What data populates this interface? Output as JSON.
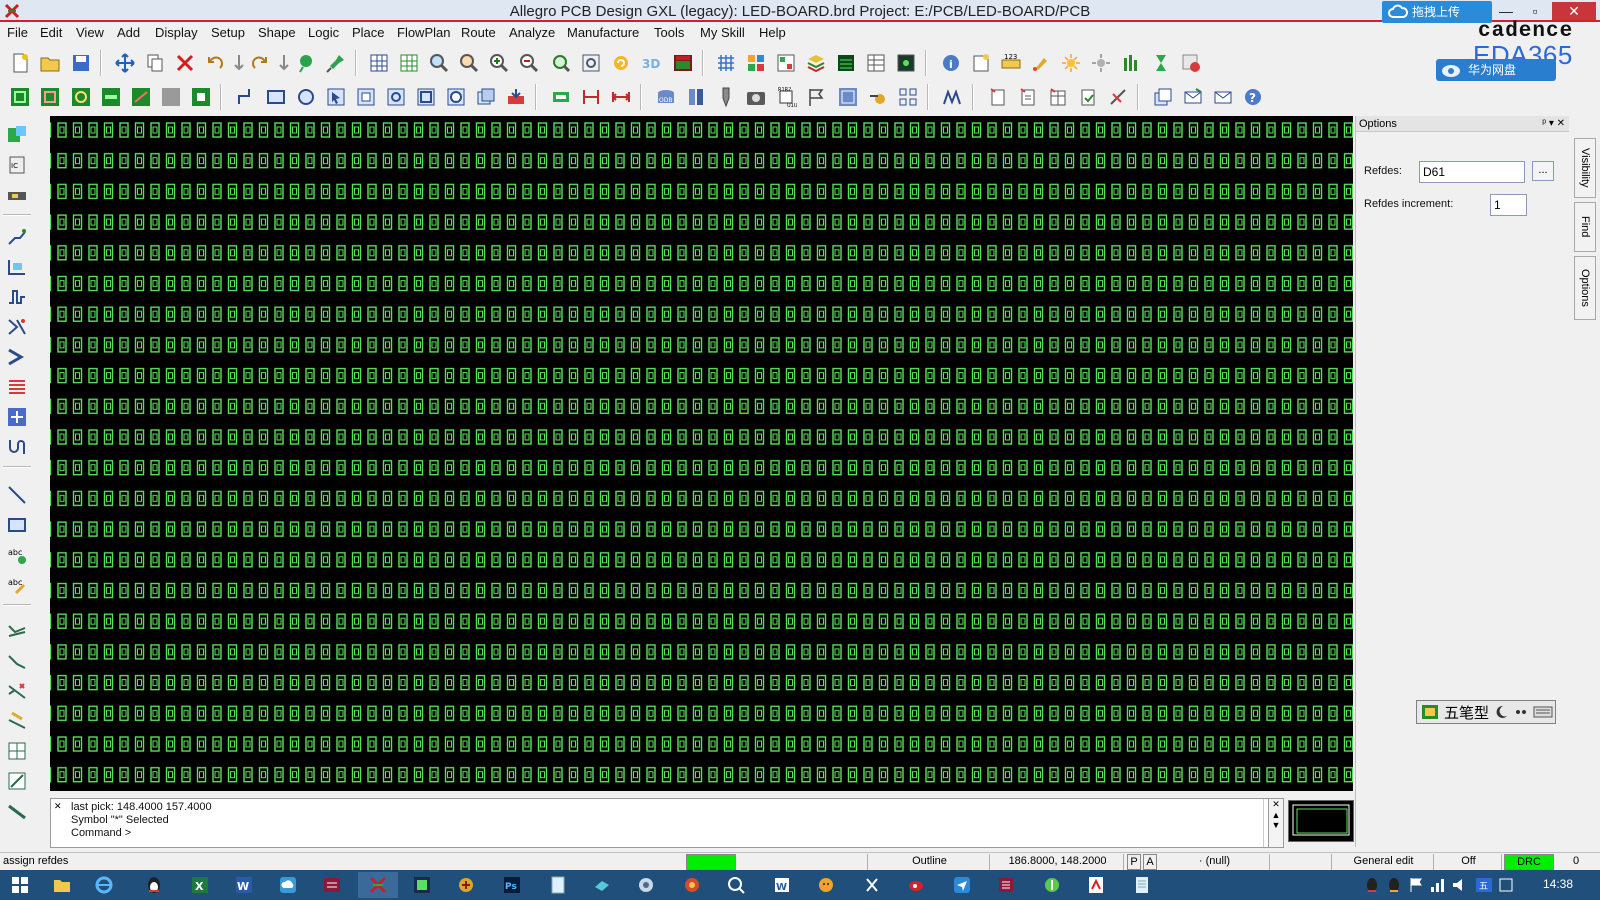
{
  "window": {
    "title": "Allegro PCB Design GXL (legacy): LED-BOARD.brd  Project: E:/PCB/LED-BOARD/PCB",
    "upload_label": "拖拽上传",
    "minimize": "—",
    "maximize": "▫",
    "close": "✕",
    "cadence_text": "cadence",
    "eda_text": "EDA365",
    "netdisk_label": "华为网盘"
  },
  "menu": [
    "File",
    "Edit",
    "View",
    "Add",
    "Display",
    "Setup",
    "Shape",
    "Logic",
    "Place",
    "FlowPlan",
    "Route",
    "Analyze",
    "Manufacture",
    "Tools",
    "My Skill",
    "Help"
  ],
  "options_panel": {
    "header": "Options",
    "header_buttons": "ᵖ ▾ ✕",
    "refdes_label": "Refdes:",
    "refdes_value": "D61",
    "browse_label": "...",
    "increment_label": "Refdes increment:",
    "increment_value": "1",
    "ime_text": "五笔型"
  },
  "side_tabs": [
    "Visibility",
    "Find",
    "Options"
  ],
  "command_window": {
    "lines": [
      "last pick:  148.4000 157.4000",
      "Symbol \"*\" Selected",
      "Command >"
    ]
  },
  "status": {
    "message": "assign refdes",
    "subclass": "Outline",
    "coordinates": "186.8000, 148.2000",
    "p_label": "P",
    "a_label": "A",
    "null_label": "· (null)",
    "mode": "General edit",
    "off_label": "Off",
    "drc_label": "DRC",
    "drc_count": "0"
  },
  "taskbar": {
    "clock": "14:38"
  },
  "colors": {
    "component_green": "#5be05b",
    "canvas_bg": "#000000",
    "drc_green": "#00ee00",
    "titlebar_accent": "#d0202a"
  }
}
